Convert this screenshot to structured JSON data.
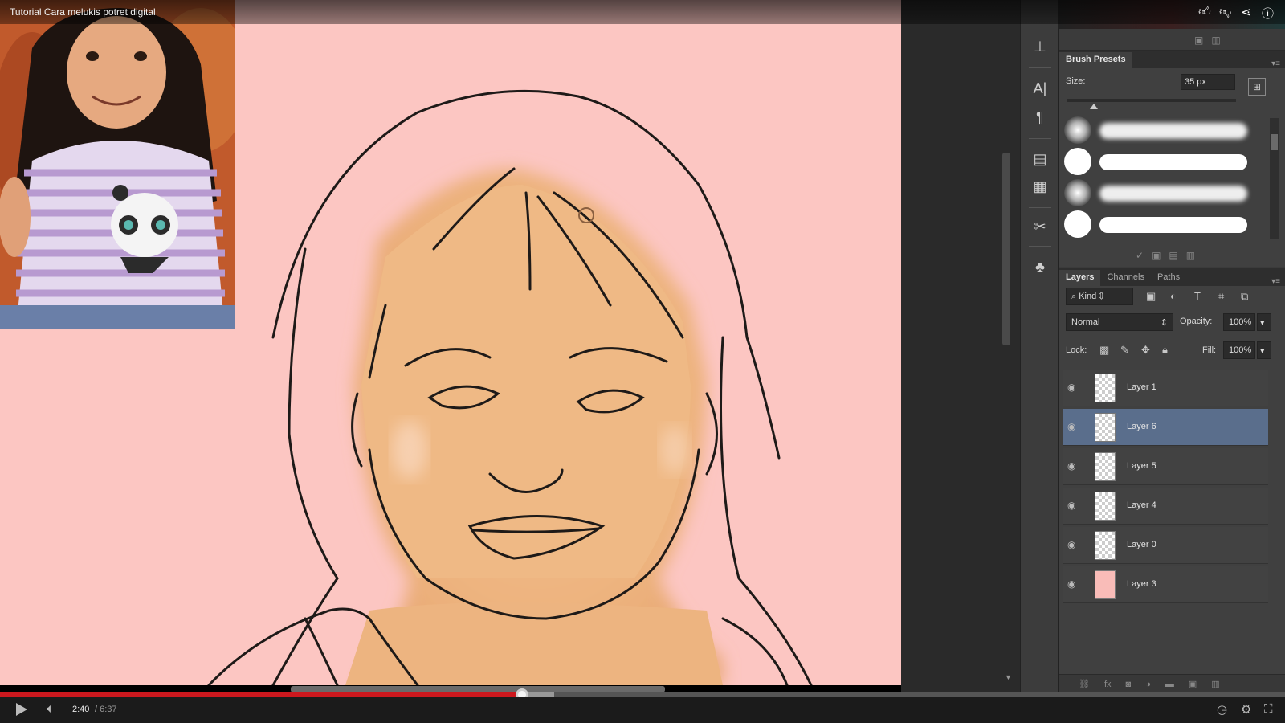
{
  "video": {
    "title": "Tutorial Cara melukis potret digital",
    "time_current": "2:40",
    "time_separator": "/",
    "time_total": "6:37",
    "progress": 0.4064,
    "buffered": 0.4314,
    "colors": {
      "progress": "#cc181e",
      "canvas_bg": "#fcc6c2",
      "skin": "#f0b884"
    }
  },
  "brush_presets": {
    "tab_label": "Brush Presets",
    "size_label": "Size:",
    "size_value": "35 px",
    "brushes": [
      {
        "type": "soft"
      },
      {
        "type": "hard"
      },
      {
        "type": "soft"
      },
      {
        "type": "hard"
      }
    ]
  },
  "layers_panel": {
    "tabs": [
      "Layers",
      "Channels",
      "Paths"
    ],
    "filter_kind": "Kind",
    "blend_mode": "Normal",
    "opacity_label": "Opacity:",
    "opacity_value": "100%",
    "lock_label": "Lock:",
    "fill_label": "Fill:",
    "fill_value": "100%",
    "layers": [
      {
        "name": "Layer 1",
        "selected": false,
        "thumb": "checker"
      },
      {
        "name": "Layer 6",
        "selected": true,
        "thumb": "checker"
      },
      {
        "name": "Layer 5",
        "selected": false,
        "thumb": "checker"
      },
      {
        "name": "Layer 4",
        "selected": false,
        "thumb": "checker"
      },
      {
        "name": "Layer 0",
        "selected": false,
        "thumb": "checker"
      },
      {
        "name": "Layer 3",
        "selected": false,
        "thumb": "pink"
      }
    ]
  },
  "icons": {
    "title_bar": [
      "like-icon",
      "dislike-icon",
      "share-icon",
      "info-icon"
    ],
    "controls": [
      "play-icon",
      "volume-icon",
      "watch-later-icon",
      "settings-icon",
      "fullscreen-icon"
    ]
  }
}
